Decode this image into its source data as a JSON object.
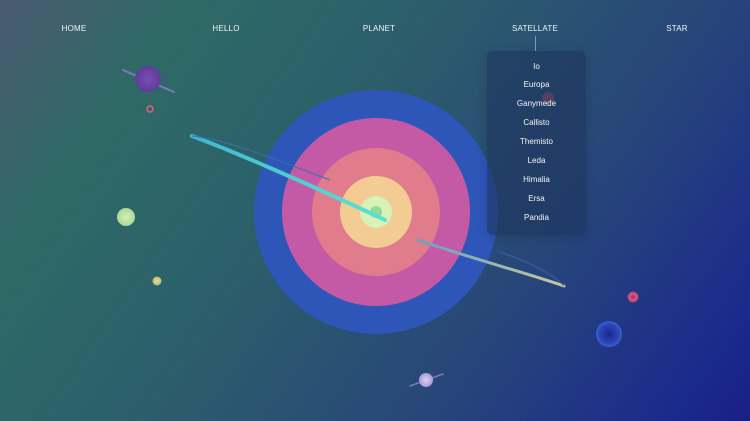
{
  "nav": {
    "items": [
      {
        "label": "HOME"
      },
      {
        "label": "HELLO"
      },
      {
        "label": "PLANET"
      },
      {
        "label": "SATELLATE"
      },
      {
        "label": "STAR"
      }
    ]
  },
  "dropdown": {
    "items": [
      "Io",
      "Europa",
      "Ganymede",
      "Callisto",
      "Themisto",
      "Leda",
      "Himalia",
      "Ersa",
      "Pandia"
    ]
  },
  "colors": {
    "planet_outer": "#2f55b8",
    "planet_ring2": "#c25aa3",
    "planet_ring3": "#e07a8a",
    "planet_ring4": "#f0c98e",
    "planet_core": "#9fe0a3",
    "accent_orbit": "#5fd3d7"
  }
}
